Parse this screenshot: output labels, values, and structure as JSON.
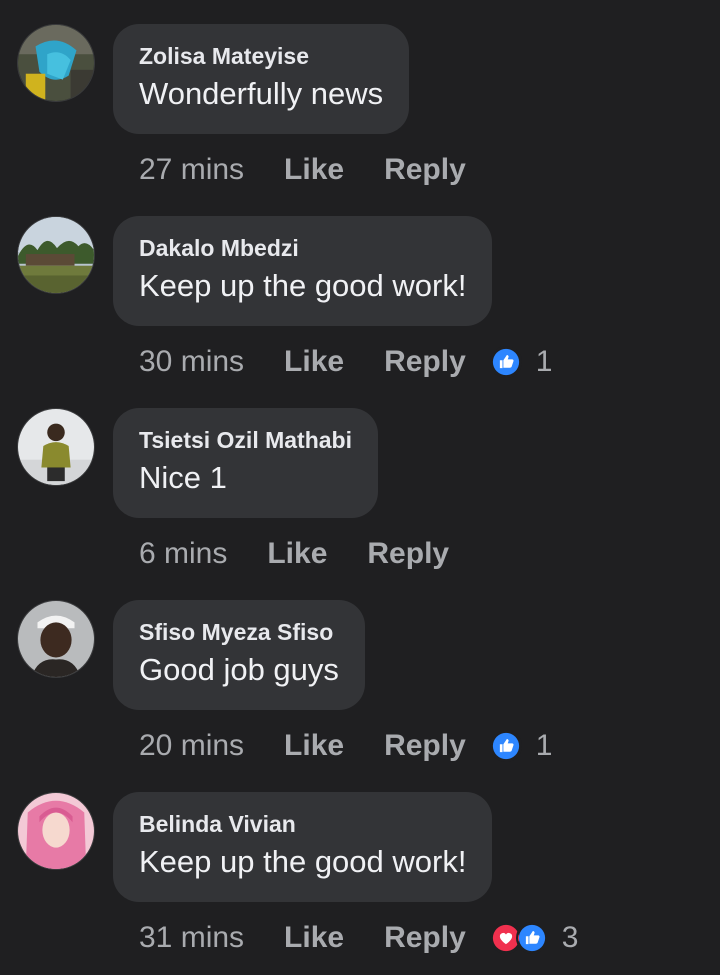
{
  "comments": [
    {
      "author": "Zolisa Mateyise",
      "text": "Wonderfully news",
      "time": "27 mins",
      "like_label": "Like",
      "reply_label": "Reply",
      "reactions": [],
      "reaction_count": ""
    },
    {
      "author": "Dakalo Mbedzi",
      "text": "Keep up the good work!",
      "time": "30 mins",
      "like_label": "Like",
      "reply_label": "Reply",
      "reactions": [
        "like-icon"
      ],
      "reaction_count": "1"
    },
    {
      "author": "Tsietsi Ozil Mathabi",
      "text": "Nice 1",
      "time": "6 mins",
      "like_label": "Like",
      "reply_label": "Reply",
      "reactions": [],
      "reaction_count": ""
    },
    {
      "author": "Sfiso Myeza Sfiso",
      "text": "Good job guys",
      "time": "20 mins",
      "like_label": "Like",
      "reply_label": "Reply",
      "reactions": [
        "like-icon"
      ],
      "reaction_count": "1"
    },
    {
      "author": "Belinda Vivian",
      "text": "Keep up the good work!",
      "time": "31 mins",
      "like_label": "Like",
      "reply_label": "Reply",
      "reactions": [
        "love-icon",
        "like-icon"
      ],
      "reaction_count": "3"
    }
  ],
  "colors": {
    "background": "#1f1f21",
    "bubble": "#333437",
    "like_blue": "#2d86ff",
    "love_red": "#f0304e",
    "muted_text": "#a9abaf"
  }
}
